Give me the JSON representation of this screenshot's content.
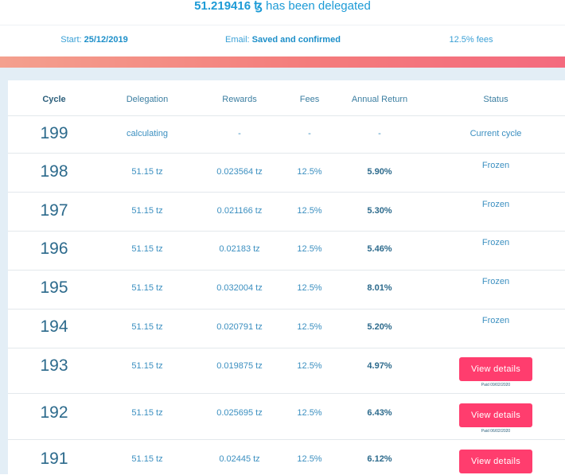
{
  "header": {
    "amount": "51.219416 ꜩ",
    "delegated_text": "has been delegated"
  },
  "summary": {
    "start_label": "Start:",
    "start_value": "25/12/2019",
    "email_label": "Email:",
    "email_value": "Saved and confirmed",
    "fees": "12.5% fees"
  },
  "table": {
    "columns": [
      "Cycle",
      "Delegation",
      "Rewards",
      "Fees",
      "Annual Return",
      "Status"
    ],
    "rows": [
      {
        "cycle": "199",
        "delegation": "calculating",
        "rewards": "-",
        "fees": "-",
        "annual_return": "-",
        "status": "Current cycle"
      },
      {
        "cycle": "198",
        "delegation": "51.15 tz",
        "rewards": "0.023564 tz",
        "fees": "12.5%",
        "annual_return": "5.90%",
        "status": "Frozen"
      },
      {
        "cycle": "197",
        "delegation": "51.15 tz",
        "rewards": "0.021166 tz",
        "fees": "12.5%",
        "annual_return": "5.30%",
        "status": "Frozen"
      },
      {
        "cycle": "196",
        "delegation": "51.15 tz",
        "rewards": "0.02183 tz",
        "fees": "12.5%",
        "annual_return": "5.46%",
        "status": "Frozen"
      },
      {
        "cycle": "195",
        "delegation": "51.15 tz",
        "rewards": "0.032004 tz",
        "fees": "12.5%",
        "annual_return": "8.01%",
        "status": "Frozen"
      },
      {
        "cycle": "194",
        "delegation": "51.15 tz",
        "rewards": "0.020791 tz",
        "fees": "12.5%",
        "annual_return": "5.20%",
        "status": "Frozen"
      },
      {
        "cycle": "193",
        "delegation": "51.15 tz",
        "rewards": "0.019875 tz",
        "fees": "12.5%",
        "annual_return": "4.97%",
        "button": "View details",
        "paid": "Paid 09/02/2020"
      },
      {
        "cycle": "192",
        "delegation": "51.15 tz",
        "rewards": "0.025695 tz",
        "fees": "12.5%",
        "annual_return": "6.43%",
        "button": "View details",
        "paid": "Paid 06/02/2020"
      },
      {
        "cycle": "191",
        "delegation": "51.15 tz",
        "rewards": "0.02445 tz",
        "fees": "12.5%",
        "annual_return": "6.12%",
        "button": "View details"
      }
    ]
  },
  "colors": {
    "accent": "#1d9bd6",
    "button": "#ff3d6e",
    "panel_bg": "#e3eef6"
  }
}
